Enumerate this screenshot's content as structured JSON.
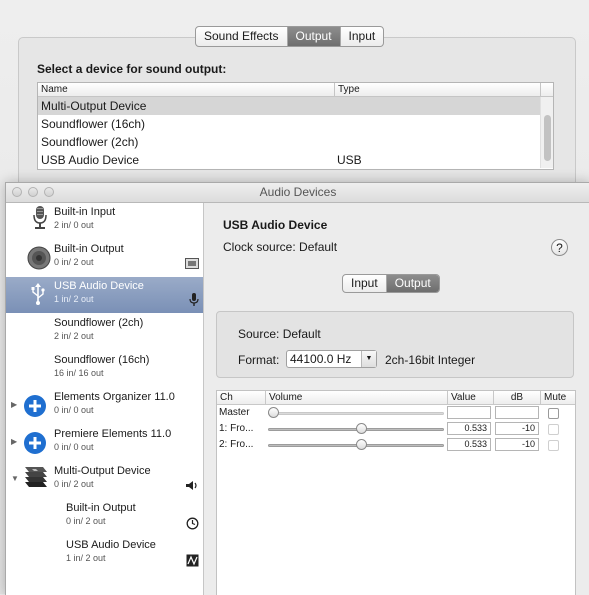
{
  "sound_prefs": {
    "tabs": [
      "Sound Effects",
      "Output",
      "Input"
    ],
    "heading": "Select a device for sound output:",
    "columns": [
      "Name",
      "Type"
    ],
    "devices": [
      {
        "name": "Multi-Output Device",
        "type": ""
      },
      {
        "name": "Soundflower (16ch)",
        "type": ""
      },
      {
        "name": "Soundflower (2ch)",
        "type": ""
      },
      {
        "name": "USB Audio Device",
        "type": "USB"
      }
    ]
  },
  "audio_devices": {
    "window_title": "Audio Devices",
    "sidebar": [
      {
        "name": "Built-in Input",
        "channels": "2 in/ 0 out"
      },
      {
        "name": "Built-in Output",
        "channels": "0 in/ 2 out"
      },
      {
        "name": "USB Audio Device",
        "channels": "1 in/ 2 out"
      },
      {
        "name": "Soundflower (2ch)",
        "channels": "2 in/ 2 out"
      },
      {
        "name": "Soundflower (16ch)",
        "channels": "16 in/ 16 out"
      },
      {
        "name": "Elements Organizer 11.0",
        "channels": "0 in/ 0 out"
      },
      {
        "name": "Premiere Elements 11.0",
        "channels": "0 in/ 0 out"
      },
      {
        "name": "Multi-Output Device",
        "channels": "0 in/ 2 out"
      },
      {
        "name": "Built-in Output",
        "channels": "0 in/ 2 out"
      },
      {
        "name": "USB Audio Device",
        "channels": "1 in/ 2 out"
      }
    ],
    "detail": {
      "device_title": "USB Audio Device",
      "clock_source": "Clock source: Default",
      "help": "?",
      "tabs": [
        "Input",
        "Output"
      ],
      "source": "Source: Default",
      "format_label": "Format:",
      "format_value": "44100.0 Hz",
      "format_desc": "2ch-16bit Integer"
    },
    "volume_table": {
      "columns": [
        "Ch",
        "Volume",
        "Value",
        "dB",
        "Mute"
      ],
      "rows": [
        {
          "ch": "Master",
          "value": "",
          "db": "",
          "level": 0.0
        },
        {
          "ch": "1: Fro...",
          "value": "0.533",
          "db": "-10",
          "level": 0.533
        },
        {
          "ch": "2: Fro...",
          "value": "0.533",
          "db": "-10",
          "level": 0.533
        }
      ]
    }
  }
}
